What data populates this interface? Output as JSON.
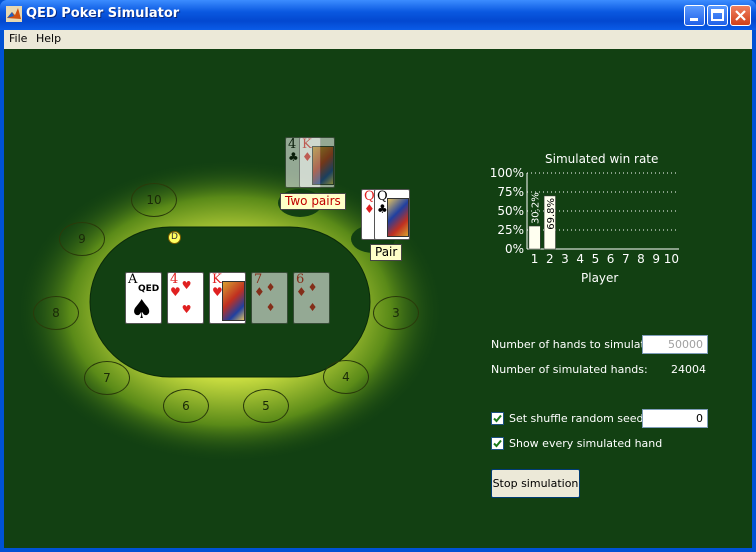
{
  "window": {
    "title": "QED Poker Simulator"
  },
  "menu": {
    "items": [
      "File",
      "Help"
    ]
  },
  "table": {
    "seats": [
      {
        "label": "10"
      },
      {
        "label": "9"
      },
      {
        "label": "8"
      },
      {
        "label": "7"
      },
      {
        "label": "6"
      },
      {
        "label": "5"
      },
      {
        "label": "4"
      },
      {
        "label": "3"
      }
    ],
    "dealer_button": "D",
    "community_cards": [
      {
        "rank": "A",
        "suit": "♠",
        "color": "black",
        "faded": false,
        "logo": "QED"
      },
      {
        "rank": "4",
        "suit": "♥",
        "color": "red",
        "faded": false
      },
      {
        "rank": "K",
        "suit": "♥",
        "color": "red",
        "faded": false
      },
      {
        "rank": "7",
        "suit": "♦",
        "color": "red",
        "faded": true
      },
      {
        "rank": "6",
        "suit": "♦",
        "color": "red",
        "faded": true
      }
    ],
    "players": [
      {
        "cards": [
          {
            "rank": "4",
            "suit": "♣",
            "color": "black"
          },
          {
            "rank": "K",
            "suit": "♦",
            "color": "red"
          }
        ],
        "hand_label": "Two pairs"
      },
      {
        "cards": [
          {
            "rank": "Q",
            "suit": "♦",
            "color": "red"
          },
          {
            "rank": "Q",
            "suit": "♣",
            "color": "black"
          }
        ],
        "hand_label": "Pair"
      }
    ]
  },
  "chart_data": {
    "type": "bar",
    "title": "Simulated win rate",
    "xlabel": "Player",
    "categories": [
      "1",
      "2",
      "3",
      "4",
      "5",
      "6",
      "7",
      "8",
      "9",
      "10"
    ],
    "values": [
      30.2,
      69.8,
      0,
      0,
      0,
      0,
      0,
      0,
      0,
      0
    ],
    "data_labels": [
      "30.2%",
      "69.8%",
      "",
      "",
      "",
      "",
      "",
      "",
      "",
      ""
    ],
    "yticks": [
      "0%",
      "25%",
      "50%",
      "75%",
      "100%"
    ],
    "ylim": [
      0,
      100
    ],
    "grid": true,
    "colors": {
      "bar": "#fffff0",
      "text": "#ffffff"
    }
  },
  "controls": {
    "hands_to_simulate_label": "Number of hands to simulate:",
    "hands_to_simulate_value": "50000",
    "simulated_hands_label": "Number of simulated hands:",
    "simulated_hands_value": "24004",
    "shuffle_seed_label": "Set shuffle random seed:",
    "shuffle_seed_checked": true,
    "shuffle_seed_value": "0",
    "show_every_hand_label": "Show every simulated hand",
    "show_every_hand_checked": true,
    "stop_button_label": "Stop simulation"
  }
}
